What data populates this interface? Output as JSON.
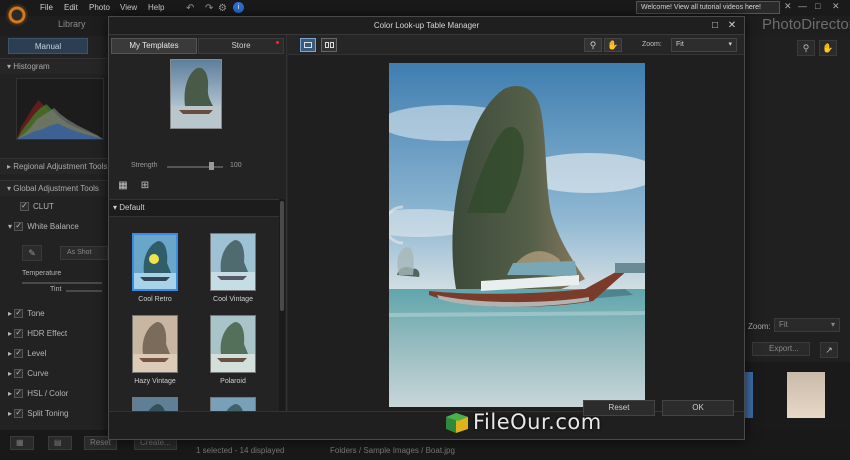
{
  "app": {
    "menu": [
      "File",
      "Edit",
      "Photo",
      "View",
      "Help"
    ],
    "library_tab": "Library",
    "product_name": "PhotoDirector",
    "welcome_banner": "Welcome! View all tutorial videos here!",
    "info_badge": "i"
  },
  "left_panel": {
    "manual_tab": "Manual",
    "histogram_label": "Histogram",
    "regional_label": "Regional Adjustment Tools",
    "global_label": "Global Adjustment Tools",
    "clut_label": "CLUT",
    "white_balance_label": "White Balance",
    "as_shot": "As Shot",
    "temperature_label": "Temperature",
    "tint_label": "Tint",
    "sections": [
      "Tone",
      "HDR Effect",
      "Level",
      "Curve",
      "HSL / Color",
      "Split Toning"
    ]
  },
  "bottom": {
    "reset": "Reset",
    "create": "Create...",
    "status": "1 selected - 14 displayed",
    "path": "Folders / Sample Images / Boat.jpg"
  },
  "right_panel": {
    "zoom_label": "Zoom:",
    "zoom_value": "Fit",
    "export_label": "Export..."
  },
  "dialog": {
    "title": "Color Look-up Table Manager",
    "tabs": {
      "templates": "My Templates",
      "store": "Store"
    },
    "strength_label": "Strength",
    "strength_value": "100",
    "category": "Default",
    "templates": [
      {
        "name": "Cool Retro",
        "selected": true
      },
      {
        "name": "Cool Vintage",
        "selected": false
      },
      {
        "name": "Hazy Vintage",
        "selected": false
      },
      {
        "name": "Polaroid",
        "selected": false
      },
      {
        "name": "",
        "selected": false
      },
      {
        "name": "",
        "selected": false
      }
    ],
    "zoom_label": "Zoom:",
    "zoom_value": "Fit",
    "reset_button": "Reset",
    "ok_button": "OK"
  },
  "watermark": {
    "text": "FileOur.com"
  },
  "colors": {
    "accent": "#3d8be0",
    "dialog_bg": "#262626",
    "logo_orange": "#d47a1e"
  }
}
